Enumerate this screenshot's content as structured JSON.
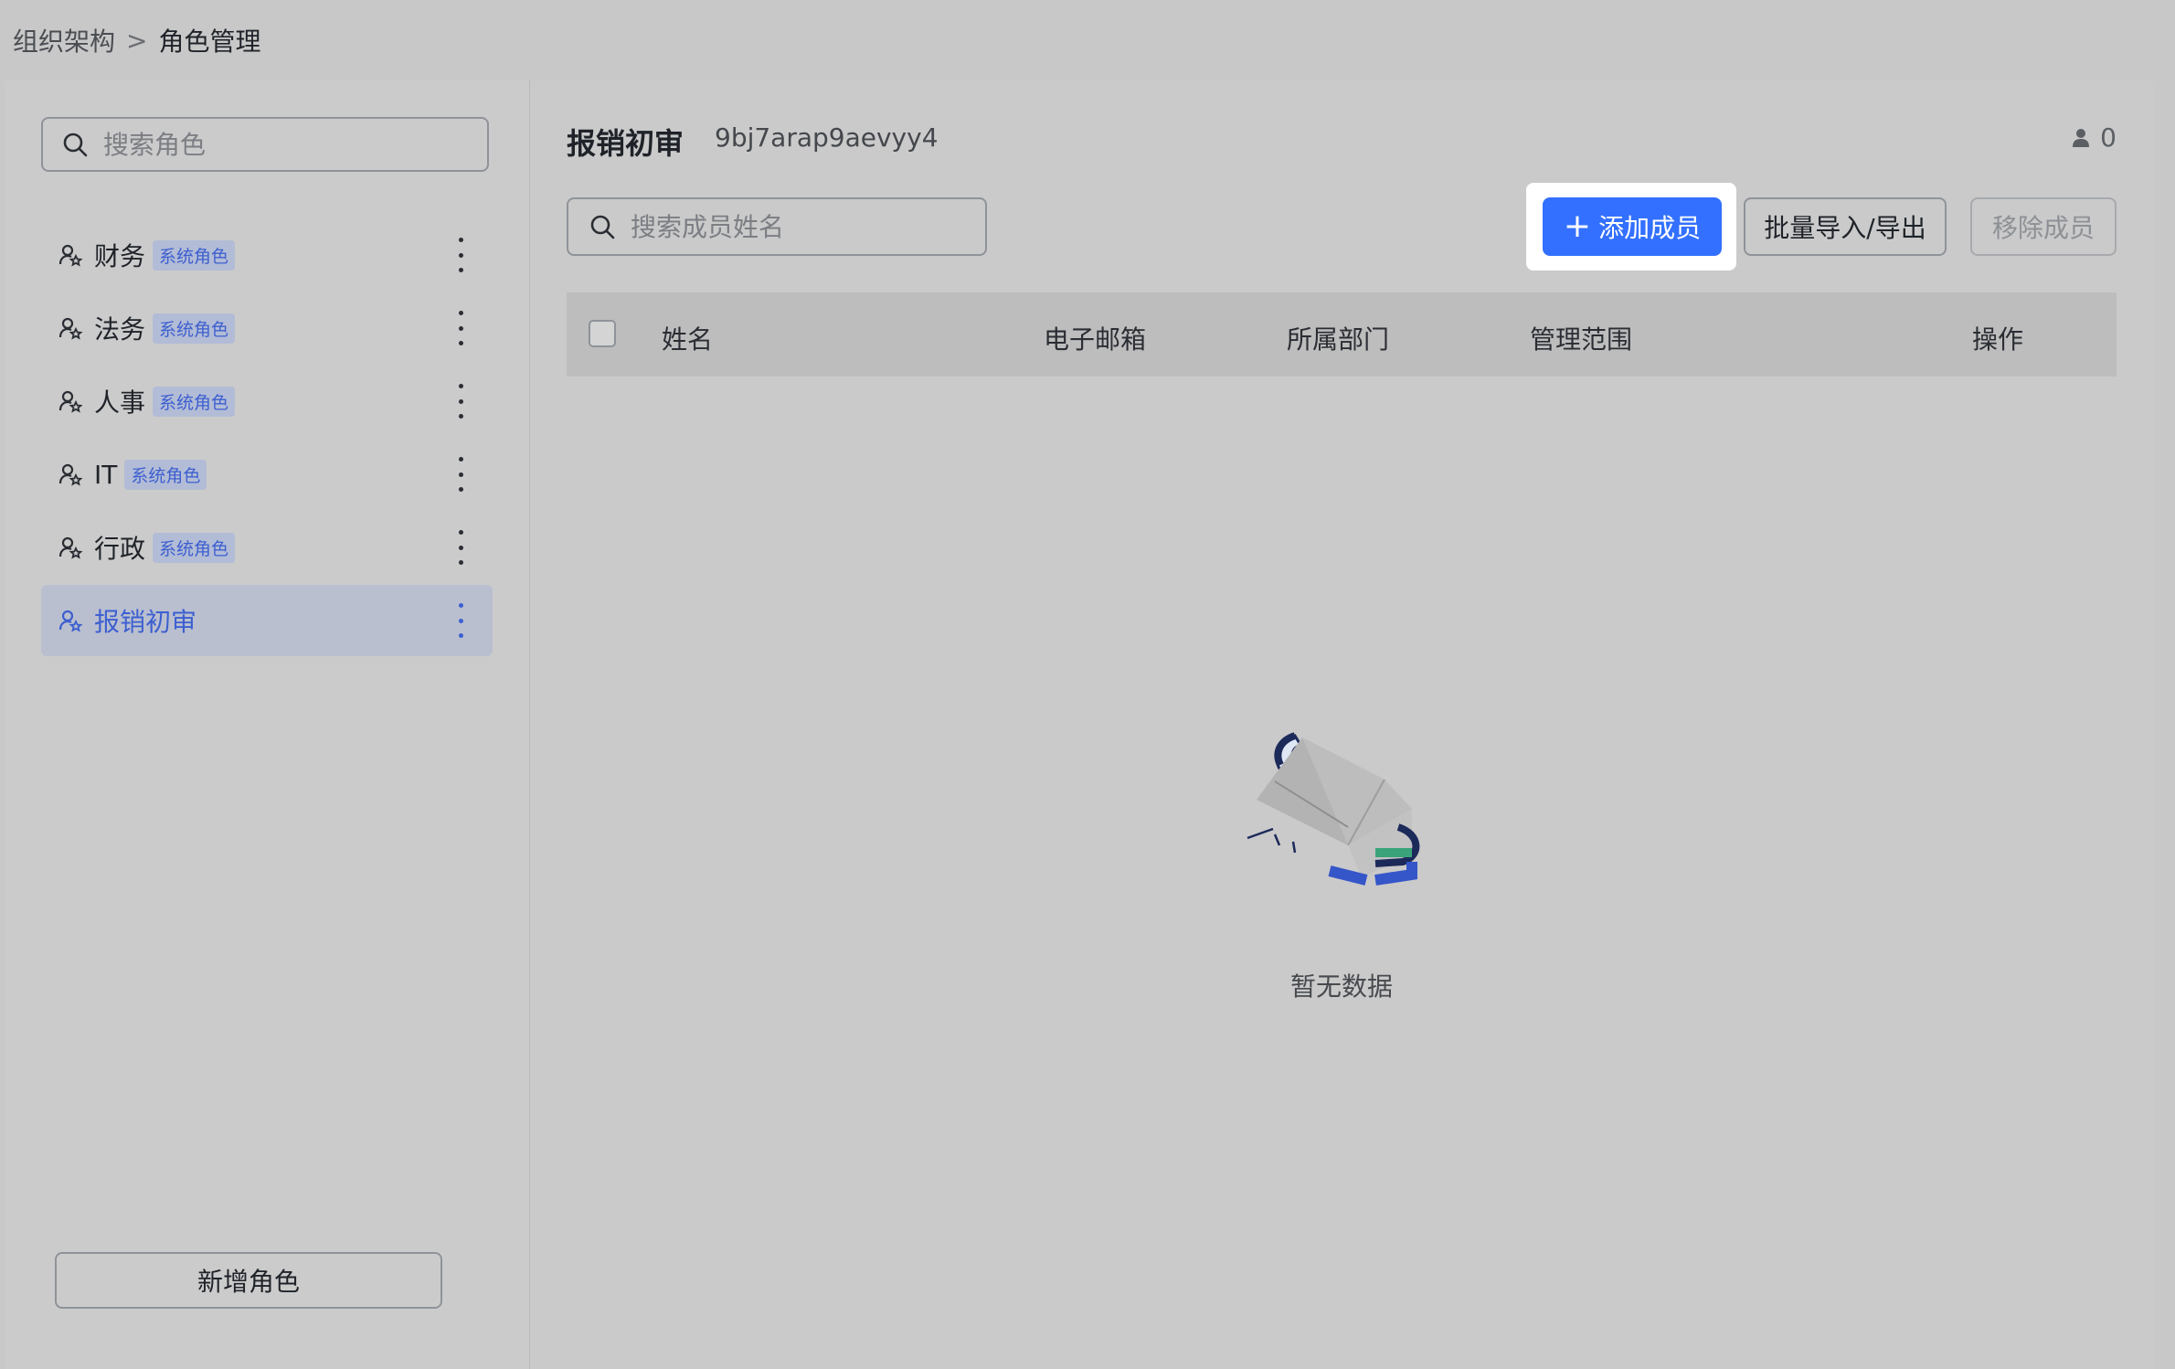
{
  "breadcrumb": {
    "parent": "组织架构",
    "separator": ">",
    "current": "角色管理"
  },
  "sidebar": {
    "search_placeholder": "搜索角色",
    "roles": [
      {
        "name": "财务",
        "tag": "系统角色",
        "active": false
      },
      {
        "name": "法务",
        "tag": "系统角色",
        "active": false
      },
      {
        "name": "人事",
        "tag": "系统角色",
        "active": false
      },
      {
        "name": "IT",
        "tag": "系统角色",
        "active": false
      },
      {
        "name": "行政",
        "tag": "系统角色",
        "active": false
      },
      {
        "name": "报销初审",
        "tag": "",
        "active": true
      }
    ],
    "add_role_label": "新增角色"
  },
  "main": {
    "role_title": "报销初审",
    "role_id": "9bj7arap9aevyy4",
    "member_count": "0",
    "member_search_placeholder": "搜索成员姓名",
    "buttons": {
      "add_member": "添加成员",
      "batch_import_export": "批量导入/导出",
      "remove_member": "移除成员"
    },
    "table": {
      "columns": [
        "姓名",
        "电子邮箱",
        "所属部门",
        "管理范围",
        "操作"
      ]
    },
    "empty_text": "暂无数据"
  },
  "colors": {
    "primary": "#3370ff",
    "active_text": "#3d5fd0",
    "tag_bg": "#b2bcd6"
  }
}
